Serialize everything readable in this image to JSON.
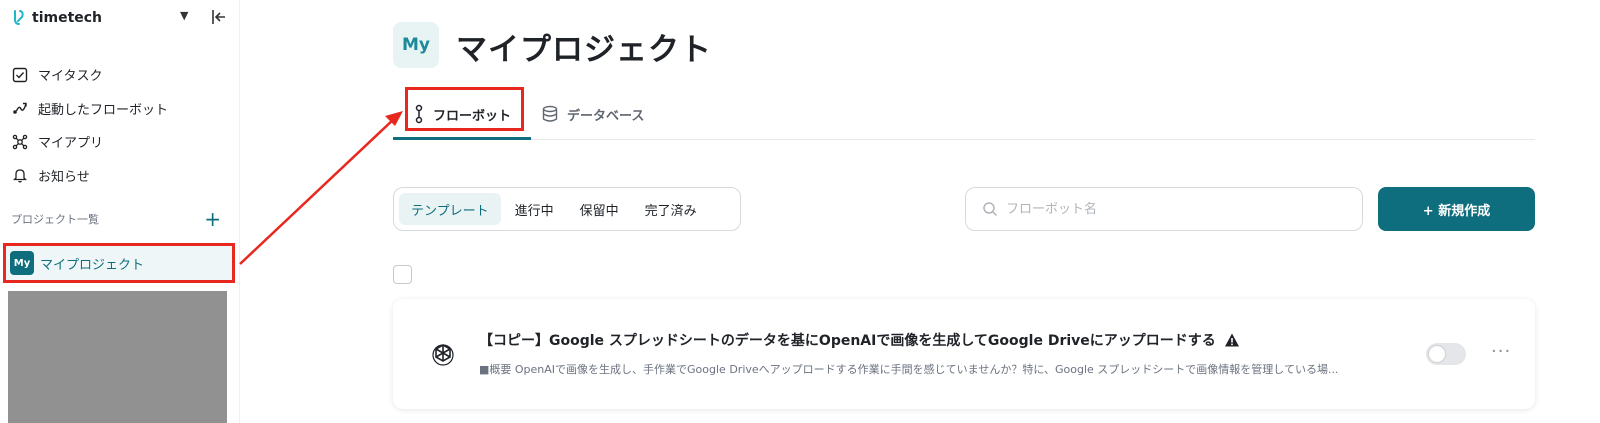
{
  "sidebar": {
    "brand": "timetech",
    "nav": [
      {
        "label": "マイタスク",
        "icon": "task-check-icon"
      },
      {
        "label": "起動したフローボット",
        "icon": "flow-launch-icon"
      },
      {
        "label": "マイアプリ",
        "icon": "apps-network-icon"
      },
      {
        "label": "お知らせ",
        "icon": "bell-icon"
      }
    ],
    "projects_heading": "プロジェクト一覧",
    "add_symbol": "+",
    "project": {
      "badge": "My",
      "label": "マイプロジェクト"
    }
  },
  "page": {
    "icon_text": "My",
    "title": "マイプロジェクト"
  },
  "tabs": [
    {
      "label": "フローボット",
      "active": true
    },
    {
      "label": "データベース",
      "active": false
    }
  ],
  "filters": [
    "テンプレート",
    "進行中",
    "保留中",
    "完了済み"
  ],
  "search": {
    "placeholder": "フローボット名"
  },
  "new_button": "+ 新規作成",
  "flowbots": [
    {
      "title": "【コピー】Google スプレッドシートのデータを基にOpenAIで画像を生成してGoogle Driveにアップロードする",
      "description": "■概要 OpenAIで画像を生成し、手作業でGoogle Driveへアップロードする作業に手間を感じていませんか？特に、Google スプレッドシートで画像情報を管理している場...",
      "enabled": false,
      "more": "···"
    }
  ],
  "colors": {
    "accent": "#0e6e7e",
    "highlight": "#e8281e"
  }
}
